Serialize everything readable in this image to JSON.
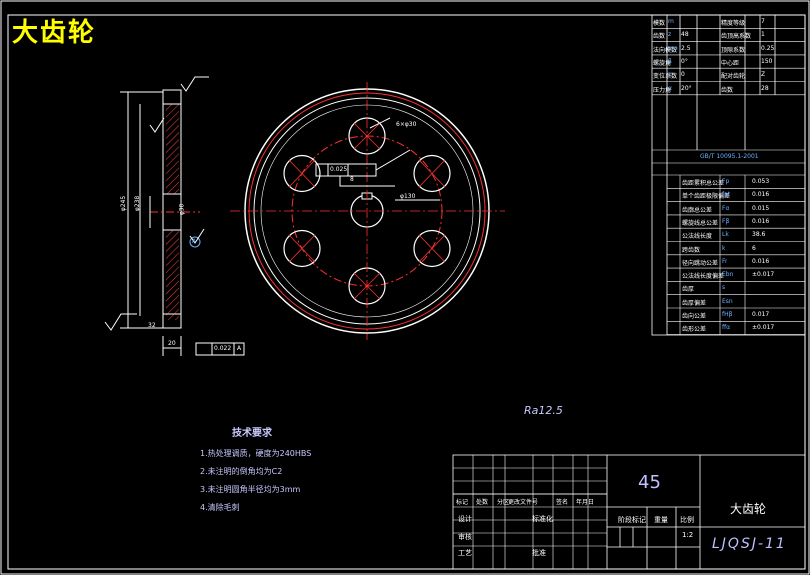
{
  "title": "大齿轮",
  "roughness_general": "Ra12.5",
  "tech_requirements": {
    "heading": "技术要求",
    "items": [
      "1.热处理调质，硬度为240HBS",
      "2.未注明的倒角均为C2",
      "3.未注明圆角半径均为3mm",
      "4.清除毛刺"
    ]
  },
  "param_table": {
    "rows": [
      [
        "模数",
        "m",
        "",
        "精度等级",
        "7"
      ],
      [
        "齿数",
        "z",
        "48",
        "齿顶高系数",
        "1"
      ],
      [
        "法向模数",
        "mn",
        "2.5",
        "顶隙系数",
        "0.25"
      ],
      [
        "螺旋角",
        "β",
        "0°",
        "中心距",
        "150"
      ],
      [
        "变位系数",
        "x",
        "0",
        "配对齿轮",
        "Z"
      ],
      [
        "压力角",
        "α",
        "20°",
        "齿数",
        "28"
      ]
    ],
    "standard": "GB/T 10095.1-2001",
    "check_rows": [
      [
        "齿距累积总公差",
        "Fp",
        "0.053"
      ],
      [
        "单个齿距极限偏差",
        "fpt",
        "0.016"
      ],
      [
        "齿廓总公差",
        "Fα",
        "0.015"
      ],
      [
        "螺旋线总公差",
        "Fβ",
        "0.016"
      ],
      [
        "公法线长度",
        "Lk",
        "38.6"
      ],
      [
        "跨齿数",
        "k",
        "6"
      ],
      [
        "径向跳动公差",
        "Fr",
        "0.016"
      ],
      [
        "公法线长度偏差",
        "Ebn",
        "±0.017"
      ],
      [
        "齿厚",
        "s",
        ""
      ],
      [
        "齿厚偏差",
        "Esn",
        ""
      ],
      [
        "齿向公差",
        "fHβ",
        "0.017"
      ],
      [
        "齿形公差",
        "ffα",
        "±0.017"
      ]
    ]
  },
  "title_block": {
    "material": "45",
    "part_name": "大齿轮",
    "drawing_no": "LJQSJ-11",
    "scale": "1:2",
    "headers": [
      "标记",
      "处数",
      "分区",
      "更改文件号",
      "签名",
      "年月日"
    ],
    "left_labels": [
      "设计",
      "审核",
      "工艺"
    ],
    "std_label": "标准化",
    "approve_label": "批准",
    "stage_label": "阶段标记",
    "weight_label": "重量",
    "scale_label": "比例"
  },
  "dimensions": {
    "left_phi_outer": "φ245",
    "left_phi_root": "φ238",
    "left_phi_bore": "φ30",
    "width": "20",
    "run_out": "0.022",
    "datum": "A",
    "hub": "32",
    "hole_count": "6×φ30",
    "pcd": "φ130",
    "keyway": "8",
    "tol": "0.025"
  }
}
